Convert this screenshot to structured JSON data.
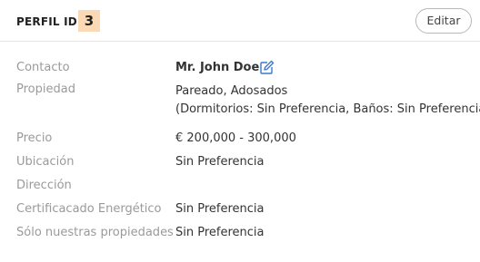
{
  "header": {
    "profile_label": "PERFIL ID",
    "profile_id": "3",
    "edit_label": "Editar"
  },
  "details": {
    "contact": {
      "label": "Contacto",
      "value": "Mr. John Doe",
      "edit_icon": "pencil-square-icon"
    },
    "property": {
      "label": "Propiedad",
      "value_line1": "Pareado, Adosados",
      "value_line2": "(Dormitorios: Sin Preferencia, Baños: Sin Preferencia)"
    },
    "price": {
      "label": "Precio",
      "value": "€ 200,000 - 300,000"
    },
    "location": {
      "label": "Ubicación",
      "value": "Sin Preferencia"
    },
    "address": {
      "label": "Dirección",
      "value": ""
    },
    "energy_certificate": {
      "label": "Certificacado Energético",
      "value": "Sin Preferencia"
    },
    "own_properties_only": {
      "label": "Sólo nuestras propiedades",
      "value": "Sin Preferencia"
    }
  },
  "colors": {
    "id_badge_bg": "#fbd9b4",
    "edit_icon": "#3a78c9",
    "label_text": "#9a9a9a"
  }
}
